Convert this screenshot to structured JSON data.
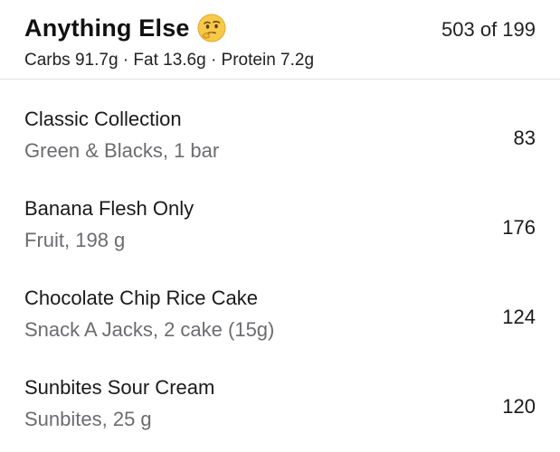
{
  "meal": {
    "title": "Anything Else",
    "emoji_icon": "thinking-face-icon",
    "totals": "503 of 199",
    "macros": "Carbs 91.7g · Fat 13.6g · Protein 7.2g"
  },
  "foods": [
    {
      "name": "Classic Collection",
      "detail": "Green & Blacks, 1 bar",
      "calories": "83"
    },
    {
      "name": "Banana Flesh Only",
      "detail": "Fruit, 198 g",
      "calories": "176"
    },
    {
      "name": "Chocolate Chip Rice Cake",
      "detail": "Snack A Jacks, 2 cake (15g)",
      "calories": "124"
    },
    {
      "name": "Sunbites Sour Cream",
      "detail": "Sunbites, 25 g",
      "calories": "120"
    }
  ],
  "colors": {
    "detail_text": "#6c6c70",
    "divider": "#e3e3e6",
    "emoji_face": "#f7c948"
  }
}
